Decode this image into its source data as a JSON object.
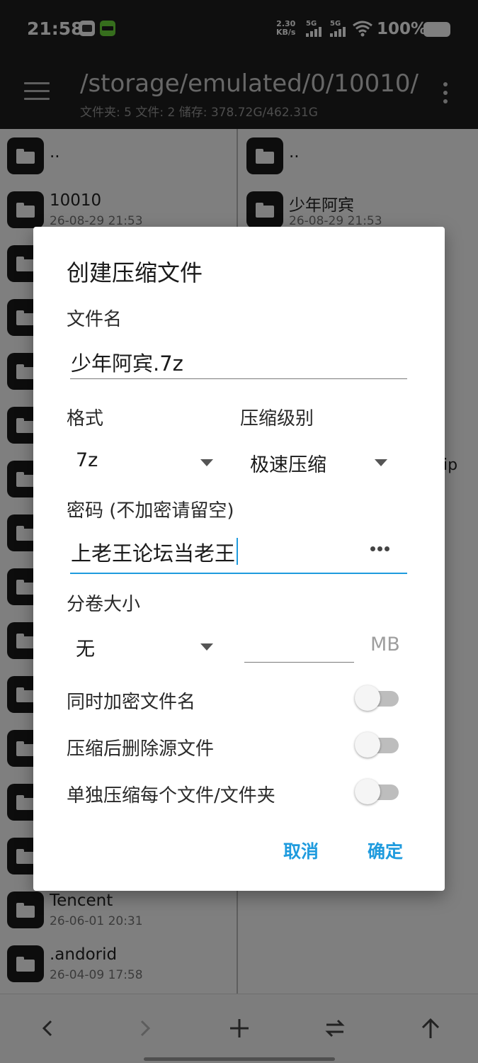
{
  "status_bar": {
    "time": "21:58",
    "net_speed_value": "2.30",
    "net_speed_unit": "KB/s",
    "sim1_label": "5G",
    "sim2_label": "5G",
    "battery": "100%",
    "icons": [
      "app-notify-icon",
      "app-notify-icon",
      "signal-icon",
      "signal-icon",
      "wifi-icon",
      "battery-icon"
    ]
  },
  "header": {
    "path": "/storage/emulated/0/10010/",
    "info": "文件夹: 5  文件: 2  储存: 378.72G/462.31G"
  },
  "left_pane": {
    "rows": [
      {
        "name": "..",
        "date": ""
      },
      {
        "name": "10010",
        "date": "26-08-29 21:53"
      }
    ],
    "bottom_rows": [
      {
        "name": "Tencent",
        "date": "26-06-01 20:31"
      },
      {
        "name": ".andorid",
        "date": "26-04-09 17:58"
      }
    ]
  },
  "right_pane": {
    "rows": [
      {
        "name": "..",
        "date": ""
      },
      {
        "name": "少年阿宾",
        "date": "26-08-29 21:53"
      }
    ],
    "fragment": "ip"
  },
  "dialog": {
    "title": "创建压缩文件",
    "filename_label": "文件名",
    "filename_value": "少年阿宾.7z",
    "format_label": "格式",
    "format_value": "7z",
    "level_label": "压缩级别",
    "level_value": "极速压缩",
    "password_label": "密码 (不加密请留空)",
    "password_value": "上老王论坛当老王",
    "volume_label": "分卷大小",
    "volume_value": "无",
    "volume_unit": "MB",
    "encrypt_names_label": "同时加密文件名",
    "encrypt_names_on": false,
    "delete_source_label": "压缩后删除源文件",
    "delete_source_on": false,
    "separate_label": "单独压缩每个文件/文件夹",
    "separate_on": false,
    "cancel_label": "取消",
    "ok_label": "确定",
    "accent_color": "#1f9bde"
  },
  "toolbar": {
    "icons": [
      "back-arrow-icon",
      "forward-arrow-icon",
      "plus-icon",
      "swap-icon",
      "up-arrow-icon"
    ]
  }
}
